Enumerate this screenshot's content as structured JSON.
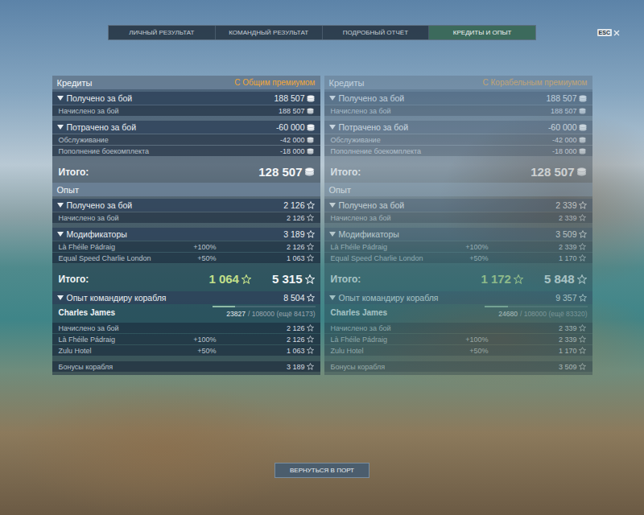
{
  "tabs": [
    {
      "label": "ЛИЧНЫЙ РЕЗУЛЬТАТ",
      "selected": false
    },
    {
      "label": "КОМАНДНЫЙ РЕЗУЛЬТАТ",
      "selected": false
    },
    {
      "label": "ПОДРОБНЫЙ ОТЧЁТ",
      "selected": false
    },
    {
      "label": "КРЕДИТЫ И ОПЫТ",
      "selected": true
    }
  ],
  "close": {
    "label": "ESC"
  },
  "panels": [
    {
      "dimmed": false,
      "credits": {
        "title": "Кредиты",
        "premium": "С Общим премиумом",
        "sections": [
          {
            "title": "Получено за бой",
            "value": "188 507",
            "expanded": true,
            "rows": [
              {
                "label": "Начислено за бой",
                "value": "188 507"
              }
            ]
          },
          {
            "title": "Потрачено за бой",
            "value": "-60 000",
            "expanded": true,
            "rows": [
              {
                "label": "Обслуживание",
                "value": "-42 000"
              },
              {
                "label": "Пополнение боекомплекта",
                "value": "-18 000"
              }
            ]
          }
        ],
        "total": {
          "label": "Итого:",
          "value": "128 507"
        }
      },
      "experience": {
        "title": "Опыт",
        "sections": [
          {
            "title": "Получено за бой",
            "value": "2 126",
            "expanded": true,
            "rows": [
              {
                "label": "Начислено за бой",
                "value": "2 126"
              }
            ]
          },
          {
            "title": "Модификаторы",
            "value": "3 189",
            "expanded": true,
            "rows": [
              {
                "label": "Là Fhéile Pádraig",
                "modifier": "+100%",
                "value": "2 126"
              },
              {
                "label": "Equal Speed Charlie London",
                "modifier": "+50%",
                "value": "1 063"
              }
            ]
          }
        ],
        "total": {
          "label": "Итого:",
          "free_value": "1 064",
          "value": "5 315"
        }
      },
      "commander": {
        "title": "Опыт командиру корабля",
        "value": "8 504",
        "expanded": true,
        "name": "Charles James",
        "level": 0.2206,
        "progress": "23827",
        "progress_rest": "/ 108000 (ещё 84173)",
        "rows": [
          {
            "label": "Начислено за бой",
            "value": "2 126"
          },
          {
            "label": "Là Fhéile Pádraig",
            "modifier": "+100%",
            "value": "2 126"
          },
          {
            "label": "Zulu Hotel",
            "modifier": "+50%",
            "value": "1 063"
          }
        ],
        "bonus": {
          "label": "Бонусы корабля",
          "value": "3 189"
        }
      }
    },
    {
      "dimmed": true,
      "credits": {
        "title": "Кредиты",
        "premium": "С Корабельным премиумом",
        "sections": [
          {
            "title": "Получено за бой",
            "value": "188 507",
            "expanded": true,
            "rows": [
              {
                "label": "Начислено за бой",
                "value": "188 507"
              }
            ]
          },
          {
            "title": "Потрачено за бой",
            "value": "-60 000",
            "expanded": true,
            "rows": [
              {
                "label": "Обслуживание",
                "value": "-42 000"
              },
              {
                "label": "Пополнение боекомплекта",
                "value": "-18 000"
              }
            ]
          }
        ],
        "total": {
          "label": "Итого:",
          "value": "128 507"
        }
      },
      "experience": {
        "title": "Опыт",
        "sections": [
          {
            "title": "Получено за бой",
            "value": "2 339",
            "expanded": true,
            "rows": [
              {
                "label": "Начислено за бой",
                "value": "2 339"
              }
            ]
          },
          {
            "title": "Модификаторы",
            "value": "3 509",
            "expanded": true,
            "rows": [
              {
                "label": "Là Fhéile Pádraig",
                "modifier": "+100%",
                "value": "2 339"
              },
              {
                "label": "Equal Speed Charlie London",
                "modifier": "+50%",
                "value": "1 170"
              }
            ]
          }
        ],
        "total": {
          "label": "Итого:",
          "free_value": "1 172",
          "value": "5 848"
        }
      },
      "commander": {
        "title": "Опыт командиру корабля",
        "value": "9 357",
        "expanded": true,
        "name": "Charles James",
        "level": 0.2285,
        "progress": "24680",
        "progress_rest": "/ 108000 (ещё 83320)",
        "rows": [
          {
            "label": "Начислено за бой",
            "value": "2 339"
          },
          {
            "label": "Là Fhéile Pádraig",
            "modifier": "+100%",
            "value": "2 339"
          },
          {
            "label": "Zulu Hotel",
            "modifier": "+50%",
            "value": "1 170"
          }
        ],
        "bonus": {
          "label": "Бонусы корабля",
          "value": "3 509"
        }
      }
    }
  ],
  "button": {
    "label": "ВЕРНУТЬСЯ В ПОРТ"
  }
}
